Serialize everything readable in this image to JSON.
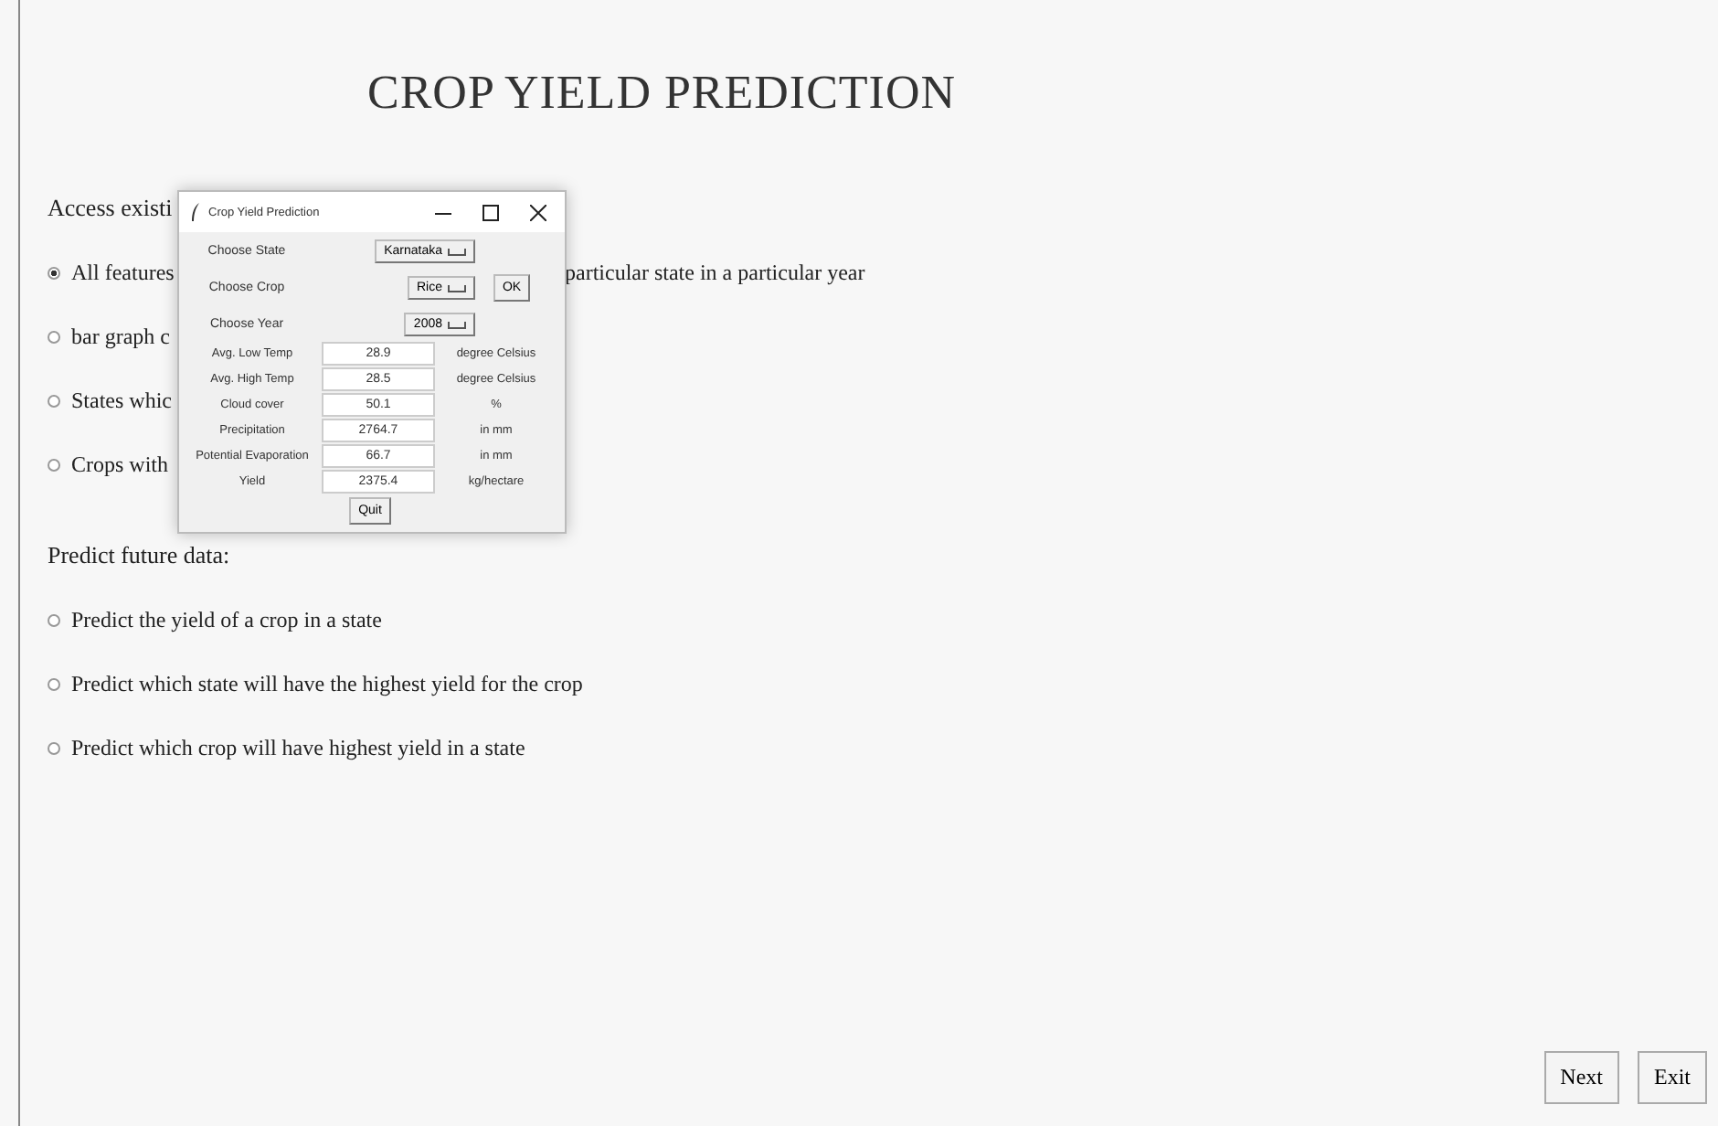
{
  "title": "CROP YIELD PREDICTION",
  "existing": {
    "heading": "Access existi",
    "options": [
      {
        "label": "All features",
        "trailing": "particular state in a particular year",
        "selected": true
      },
      {
        "label": "bar graph c",
        "selected": false
      },
      {
        "label": "States whic",
        "selected": false
      },
      {
        "label": "Crops with",
        "selected": false
      }
    ]
  },
  "future": {
    "heading": "Predict future data:",
    "options": [
      {
        "label": "Predict the yield of a crop in a state",
        "selected": false
      },
      {
        "label": "Predict which state will have the highest yield for the crop",
        "selected": false
      },
      {
        "label": "Predict which crop will have highest yield in a state",
        "selected": false
      }
    ]
  },
  "buttons": [
    "Next",
    "Exit"
  ],
  "dialog": {
    "title": "Crop Yield Prediction",
    "choices": [
      {
        "label": "Choose State",
        "value": "Karnataka"
      },
      {
        "label": "Choose Crop",
        "value": "Rice",
        "button": "OK"
      },
      {
        "label": "Choose Year",
        "value": "2008"
      }
    ],
    "fields": [
      {
        "label": "Avg. Low Temp",
        "value": "28.9",
        "unit": "degree Celsius"
      },
      {
        "label": "Avg. High Temp",
        "value": "28.5",
        "unit": "degree Celsius"
      },
      {
        "label": "Cloud cover",
        "value": "50.1",
        "unit": "%"
      },
      {
        "label": "Precipitation",
        "value": "2764.7",
        "unit": "in mm"
      },
      {
        "label": "Potential Evaporation",
        "value": "66.7",
        "unit": "in mm"
      },
      {
        "label": "Yield",
        "value": "2375.4",
        "unit": "kg/hectare"
      }
    ],
    "button": "Quit"
  }
}
